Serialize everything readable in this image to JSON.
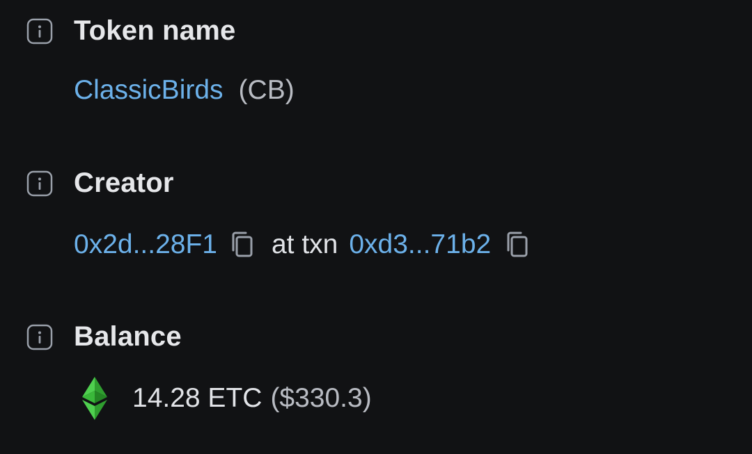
{
  "token": {
    "header": "Token name",
    "name": "ClassicBirds",
    "symbol": "(CB)"
  },
  "creator": {
    "header": "Creator",
    "address": "0x2d...28F1",
    "at_txn_label": "at txn",
    "txn": "0xd3...71b2"
  },
  "balance": {
    "header": "Balance",
    "amount": "14.28 ETC",
    "usd": "($330.3)"
  },
  "icons": {
    "info": "info-icon",
    "copy": "copy-icon",
    "coin": "ethereum-classic-icon"
  },
  "colors": {
    "background": "#111214",
    "link": "#6cb1ea",
    "text": "#e2e4e8",
    "muted": "#b9bcc3",
    "etc_green": "#3ab83a"
  }
}
